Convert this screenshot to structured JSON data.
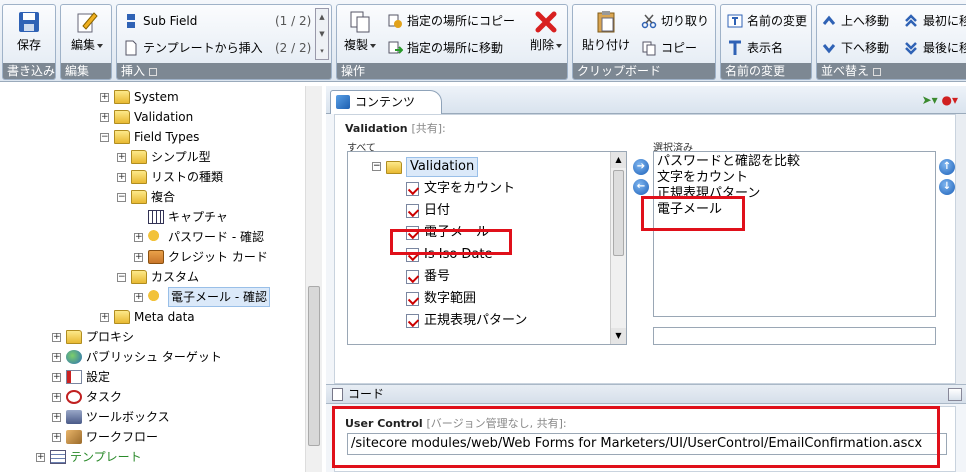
{
  "ribbon": {
    "save": {
      "label": "保存",
      "group": "書き込み"
    },
    "edit": {
      "label": "編集",
      "group": "編集"
    },
    "insert": {
      "sub_field": "Sub Field",
      "sub_field_page": "(1 / 2)",
      "insert_from_template": "テンプレートから挿入",
      "template_page": "(2 / 2)",
      "group": "挿入"
    },
    "operations": {
      "duplicate": "複製",
      "copy_to": "指定の場所にコピー",
      "move_to": "指定の場所に移動",
      "delete": "削除",
      "group": "操作"
    },
    "clipboard": {
      "paste": "貼り付け",
      "cut": "切り取り",
      "copy": "コピー",
      "group": "クリップボード"
    },
    "rename": {
      "rename": "名前の変更",
      "display_name": "表示名",
      "group": "名前の変更"
    },
    "sort": {
      "up": "上へ移動",
      "down": "下へ移動",
      "first": "最初に移",
      "last": "最後に移",
      "group": "並べ替え"
    }
  },
  "tree": {
    "items": [
      {
        "label": "System"
      },
      {
        "label": "Validation"
      },
      {
        "label": "Field Types"
      },
      {
        "label": "シンプル型"
      },
      {
        "label": "リストの種類"
      },
      {
        "label": "複合"
      },
      {
        "label": "キャプチャ"
      },
      {
        "label": "パスワード - 確認"
      },
      {
        "label": "クレジット カード"
      },
      {
        "label": "カスタム"
      },
      {
        "label": "電子メール - 確認"
      },
      {
        "label": "Meta data"
      },
      {
        "label": "プロキシ"
      },
      {
        "label": "パブリッシュ ターゲット"
      },
      {
        "label": "設定"
      },
      {
        "label": "タスク"
      },
      {
        "label": "ツールボックス"
      },
      {
        "label": "ワークフロー"
      },
      {
        "label": "テンプレート"
      }
    ]
  },
  "panel": {
    "tab_label": "コンテンツ",
    "validation_label": "Validation",
    "validation_meta": "[共有]:",
    "all_label": "すべて",
    "selected_label": "選択済み",
    "all_items": [
      "Validation",
      "文字をカウント",
      "日付",
      "電子メール",
      "Is Iso Date",
      "番号",
      "数字範囲",
      "正規表現パターン"
    ],
    "selected_items": [
      "パスワードと確認を比較",
      "文字をカウント",
      "正規表現パターン",
      "電子メール"
    ],
    "code_section": "コード",
    "user_control_label": "User Control",
    "user_control_meta": "[バージョン管理なし, 共有]:",
    "user_control_value": "/sitecore modules/web/Web Forms for Marketers/UI/UserControl/EmailConfirmation.ascx"
  },
  "colors": {
    "highlight_red": "#e0101a",
    "ribbon_group_title": "#7d8893",
    "tree_tmpl_green": "#2a8a2a"
  }
}
